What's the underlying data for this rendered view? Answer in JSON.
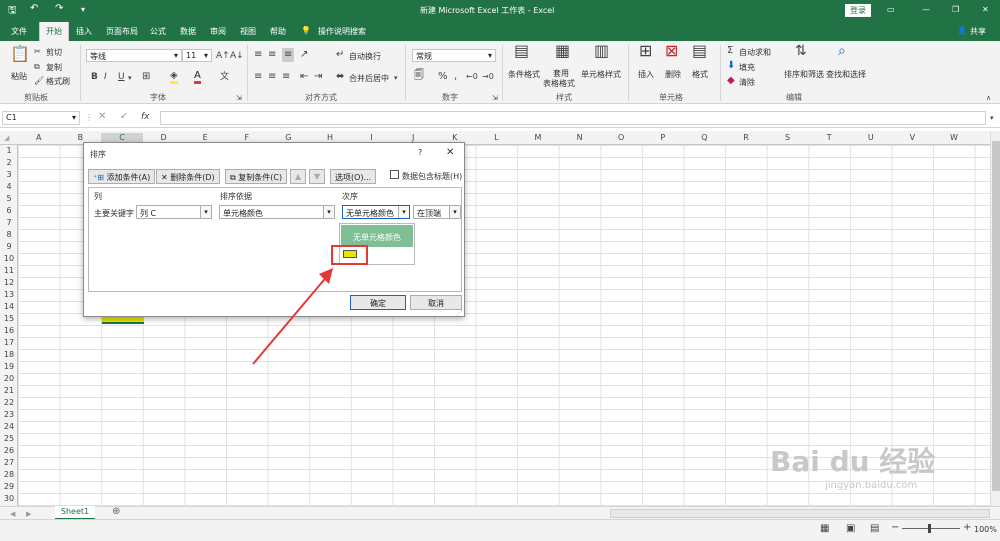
{
  "title": {
    "text": "新建 Microsoft Excel 工作表 - Excel",
    "login": "登录"
  },
  "tabs": [
    "文件",
    "开始",
    "插入",
    "页面布局",
    "公式",
    "数据",
    "审阅",
    "视图",
    "帮助"
  ],
  "search_hint": "操作说明搜索",
  "share": "共享",
  "clipboard": {
    "paste": "粘贴",
    "cut": "剪切",
    "copy": "复制",
    "format_painter": "格式刷",
    "label": "剪贴板"
  },
  "font": {
    "name": "等线",
    "size": "11",
    "label": "字体",
    "bold": "B",
    "italic": "I",
    "underline": "U"
  },
  "align": {
    "wrap": "自动换行",
    "merge": "合并后居中",
    "label": "对齐方式"
  },
  "number": {
    "format": "常规",
    "label": "数字"
  },
  "styles": {
    "cond": "条件格式",
    "table_line1": "套用",
    "table_line2": "表格格式",
    "cell": "单元格样式",
    "label": "样式"
  },
  "cells": {
    "insert": "插入",
    "delete": "删除",
    "format": "格式",
    "label": "单元格"
  },
  "editing": {
    "autosum": "自动求和",
    "fill": "填充",
    "clear": "清除",
    "sort": "排序和筛选",
    "find": "查找和选择",
    "label": "编辑"
  },
  "namebox": "C1",
  "fx": "fx",
  "columns": [
    "A",
    "B",
    "C",
    "D",
    "E",
    "F",
    "G",
    "H",
    "I",
    "J",
    "K",
    "L",
    "M",
    "N",
    "O",
    "P",
    "Q",
    "R",
    "S",
    "T",
    "U",
    "V",
    "W"
  ],
  "rows": [
    "1",
    "2",
    "3",
    "4",
    "5",
    "6",
    "7",
    "8",
    "9",
    "10",
    "11",
    "12",
    "13",
    "14",
    "15",
    "16",
    "17",
    "18",
    "19",
    "20",
    "21",
    "22",
    "23",
    "24",
    "25",
    "26",
    "27",
    "28",
    "29",
    "30"
  ],
  "sheet": {
    "tab": "Sheet1"
  },
  "status": {
    "zoom": "100%"
  },
  "dialog": {
    "title": "排序",
    "help": "?",
    "add": "添加条件(A)",
    "delete": "删除条件(D)",
    "copy": "复制条件(C)",
    "options": "选项(O)...",
    "header_checkbox": "数据包含标题(H)",
    "col_header": "列",
    "basis_header": "排序依据",
    "order_header": "次序",
    "key_label": "主要关键字",
    "key_value": "列 C",
    "basis_value": "单元格颜色",
    "order_value": "无单元格颜色",
    "position_value": "在顶端",
    "popup_item": "无单元格颜色",
    "ok": "确定",
    "cancel": "取消"
  },
  "colors": {
    "accent": "#217346",
    "yellow_fill": "#e6e600",
    "popup_green": "#7fbf94",
    "highlight_red": "#e53935"
  },
  "watermark": {
    "text": "Bai du 经验",
    "url": "jingyan.baidu.com"
  }
}
